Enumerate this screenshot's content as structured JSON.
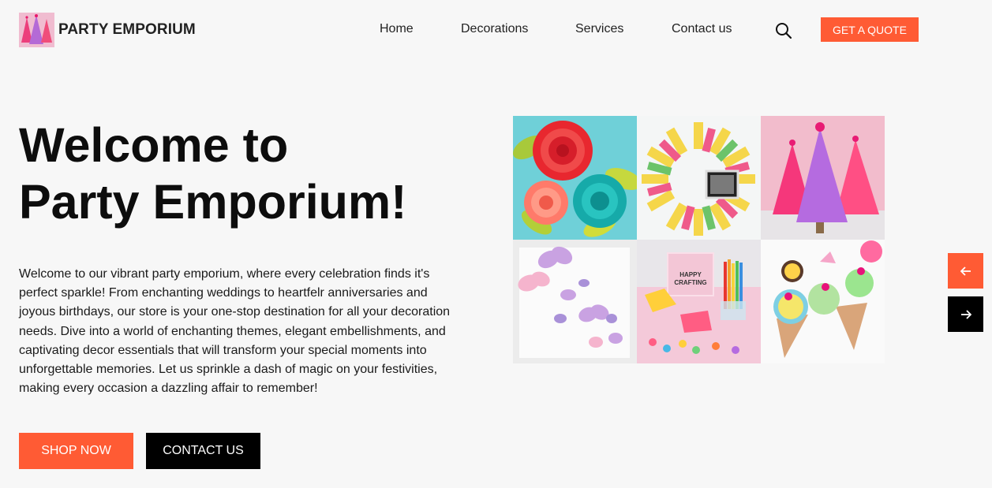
{
  "header": {
    "brand": "PARTY EMPORIUM",
    "nav": [
      "Home",
      "Decorations",
      "Services",
      "Contact us"
    ],
    "quote_button": "GET A QUOTE"
  },
  "hero": {
    "title_line1": "Welcome to",
    "title_line2": "Party Emporium!",
    "description": "Welcome to our vibrant party emporium, where every celebration finds it's perfect sparkle! From enchanting weddings to heartfelr anniversaries and joyous birthdays, our store is your one-stop destination for all your decoration needs. Dive into a world of enchanting themes, elegant embellishments, and captivating decor essentials that will transform your special moments into unforgettable memories. Let us sprinkle a dash of magic on your festivities, making every occasion a dazzling affair to remember!",
    "shop_button": "SHOP NOW",
    "contact_button": "CONTACT US"
  },
  "gallery": {
    "sign_text_1": "HAPPY",
    "sign_text_2": "CRAFTING",
    "images": [
      "paper-flowers",
      "ribbon-wreath",
      "pink-cone-trees",
      "paper-butterflies",
      "craft-desk",
      "ice-cream-cones"
    ]
  },
  "slider": {
    "prev_icon": "arrow-left-icon",
    "next_icon": "arrow-right-icon"
  },
  "colors": {
    "accent": "#ff5b34",
    "dark": "#000000",
    "background": "#f7f7f7"
  }
}
